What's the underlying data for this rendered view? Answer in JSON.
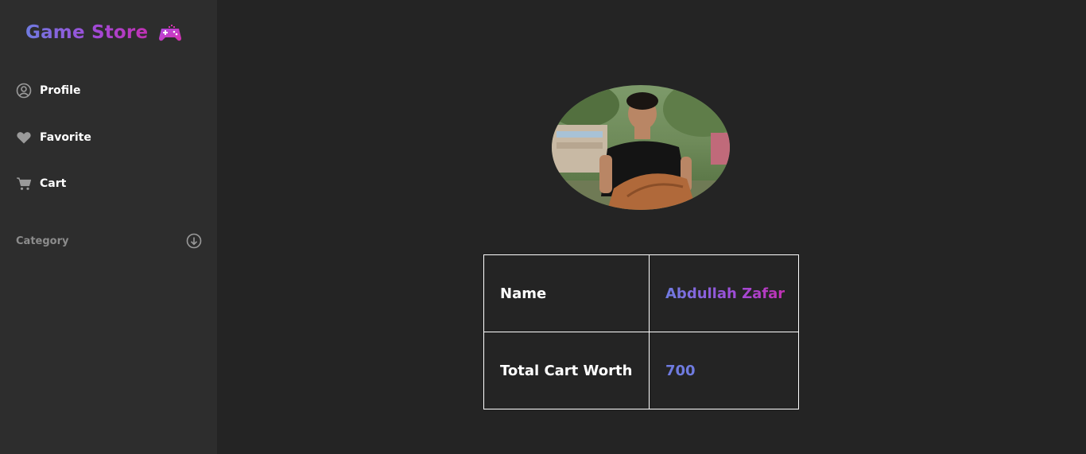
{
  "brand": {
    "title": "Game Store",
    "icon": "gamepad-icon",
    "gradient": [
      "#6f7be0",
      "#c131b3"
    ]
  },
  "sidebar": {
    "items": [
      {
        "label": "Profile",
        "icon": "user-circle-icon"
      },
      {
        "label": "Favorite",
        "icon": "heart-icon"
      },
      {
        "label": "Cart",
        "icon": "cart-icon"
      }
    ],
    "category": {
      "label": "Category",
      "icon": "arrow-down-circle-icon"
    }
  },
  "profile": {
    "avatar": "profile-photo",
    "rows": [
      {
        "label": "Name",
        "value": "Abdullah Zafar"
      },
      {
        "label": "Total Cart Worth",
        "value": "700"
      }
    ]
  },
  "colors": {
    "background": "#242424",
    "sidebar": "#2d2d2d",
    "accent": "#6f7be0",
    "accent2": "#c131b3"
  }
}
